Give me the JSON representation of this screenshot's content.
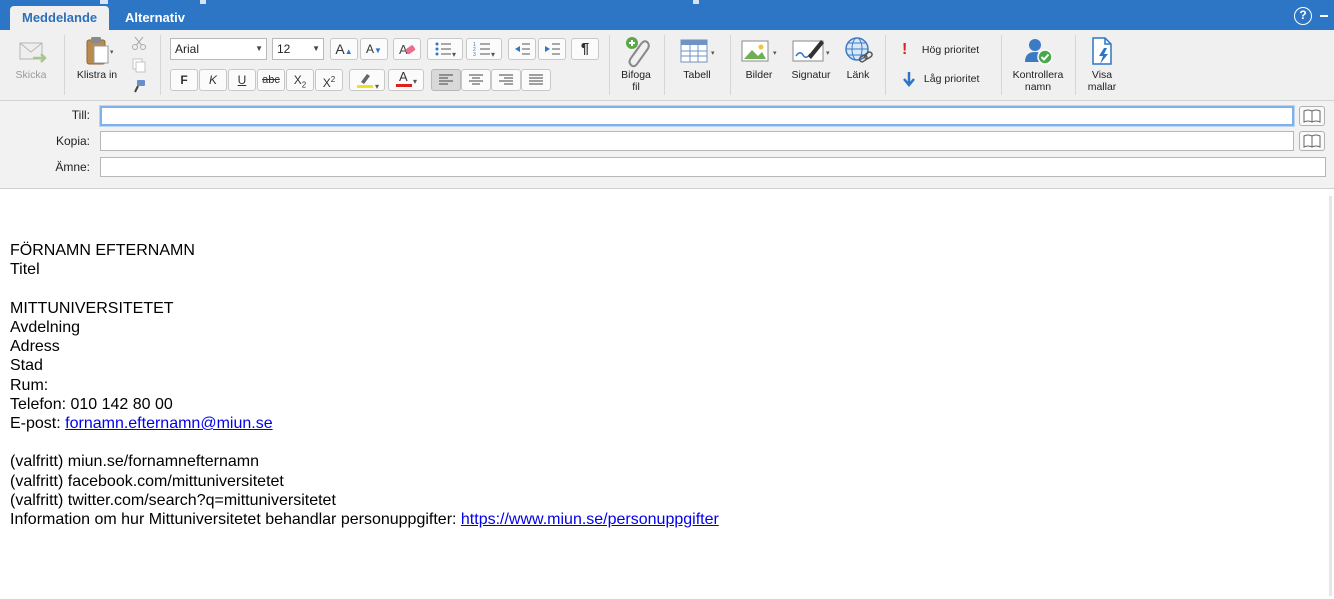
{
  "tabs": [
    {
      "label": "Meddelande",
      "active": true
    },
    {
      "label": "Alternativ",
      "active": false
    }
  ],
  "help": {
    "label": "?"
  },
  "ribbon": {
    "send": {
      "label": "Skicka"
    },
    "paste": {
      "label": "Klistra in"
    },
    "font": {
      "name": "Arial",
      "size": "12"
    },
    "format": {
      "bold": "F",
      "italic": "K",
      "underline": "U",
      "strike": "abc",
      "subscript": "X",
      "superscript": "X",
      "sub_mark": "2",
      "sup_mark": "2",
      "font_color_letter": "A",
      "pilcrow": "¶"
    },
    "attach": {
      "label1": "Bifoga",
      "label2": "fil"
    },
    "table": {
      "label": "Tabell"
    },
    "pictures": {
      "label": "Bilder"
    },
    "signature": {
      "label": "Signatur"
    },
    "link": {
      "label": "Länk"
    },
    "priority_high": {
      "label": "Hög prioritet",
      "glyph": "!"
    },
    "priority_low": {
      "label": "Låg prioritet"
    },
    "check_names": {
      "label1": "Kontrollera",
      "label2": "namn"
    },
    "templates": {
      "label1": "Visa",
      "label2": "mallar"
    }
  },
  "address": {
    "to_label": "Till:",
    "cc_label": "Kopia:",
    "subject_label": "Ämne:",
    "to_value": "",
    "cc_value": "",
    "subject_value": ""
  },
  "signature": {
    "name": "FÖRNAMN EFTERNAMN",
    "title": "Titel",
    "org": "MITTUNIVERSITETET",
    "dept": "Avdelning",
    "address": "Adress",
    "city": "Stad",
    "room": "Rum:",
    "phone": "Telefon: 010 142 80 00",
    "email_prefix": "E-post: ",
    "email": "fornamn.efternamn@miun.se",
    "web": "(valfritt) miun.se/fornamnefternamn",
    "facebook": "(valfritt) facebook.com/mittuniversitetet",
    "twitter": "(valfritt) twitter.com/search?q=mittuniversitetet",
    "privacy_prefix": "Information om hur Mittuniversitetet behandlar personuppgifter: ",
    "privacy_url": "https://www.miun.se/personuppgifter"
  },
  "colors": {
    "tabbar": "#2d76c6",
    "highlight": "#f5e11a",
    "font_color": "#e0201b",
    "link": "#0000ee",
    "focus": "#7fb0e8"
  },
  "icons": [
    "send-icon",
    "paste-icon",
    "cut-icon",
    "copy-icon",
    "format-painter-icon",
    "grow-font-icon",
    "shrink-font-icon",
    "clear-format-icon",
    "bullets-icon",
    "numbering-icon",
    "outdent-icon",
    "indent-icon",
    "pilcrow-icon",
    "highlight-icon",
    "font-color-icon",
    "align-left-icon",
    "align-center-icon",
    "align-right-icon",
    "justify-icon",
    "paperclip-icon",
    "table-icon",
    "picture-icon",
    "signature-pen-icon",
    "link-globe-icon",
    "exclamation-icon",
    "down-arrow-icon",
    "check-names-icon",
    "templates-icon",
    "address-book-icon",
    "help-icon"
  ]
}
